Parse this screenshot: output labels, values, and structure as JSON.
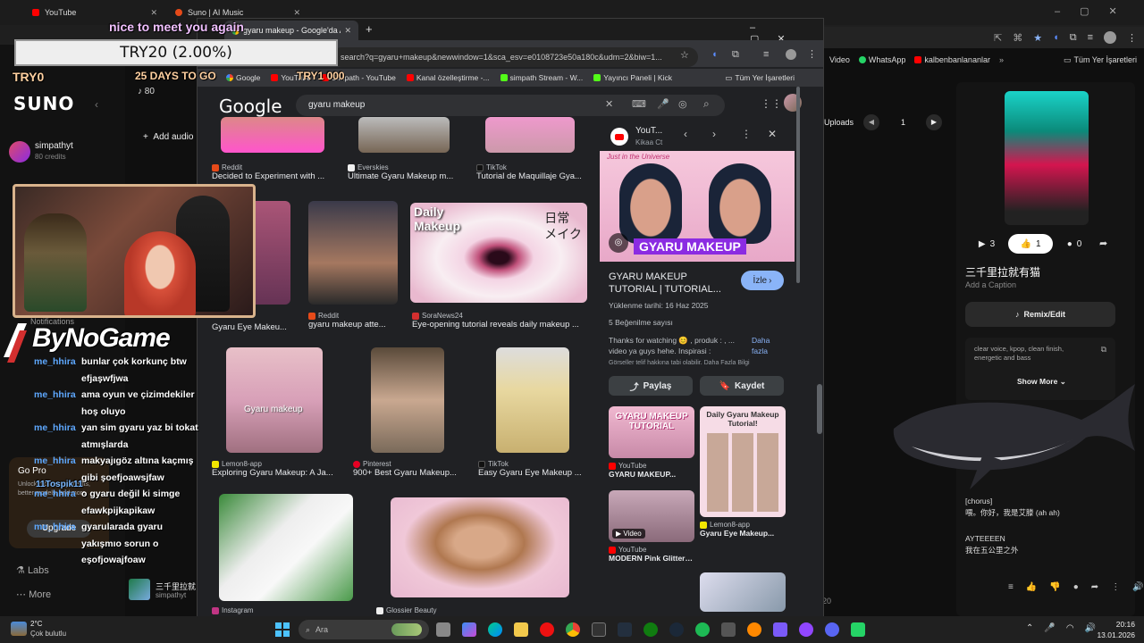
{
  "background_browser": {
    "tabs": [
      {
        "label": "YouTube"
      },
      {
        "label": "Suno | AI Music"
      }
    ],
    "bookmarks_right": [
      "Video",
      "WhatsApp",
      "kalbenbanlananlar",
      "Tüm Yer İşaretleri"
    ]
  },
  "suno": {
    "logo": "SUNO",
    "credits_count": "80",
    "user_name": "simpathyt",
    "user_credits": "80 credits",
    "add_audio_label": "Add audio",
    "notifications_label": "Notifications",
    "go_pro": {
      "title": "Go Pro",
      "subtitle": "Unlock more song credits, better models, and more",
      "upgrade_label": "Upgrade"
    },
    "labs_label": "Labs",
    "more_label": "More",
    "bottom_song": {
      "title": "三千里拉就",
      "artist": "simpathyt"
    },
    "uploads_label": "Uploads",
    "page_number": "1",
    "right_panel": {
      "stats": {
        "plays": "3",
        "likes": "1",
        "comments": "0"
      },
      "song_title": "三千里拉就有猫",
      "add_caption": "Add a Caption",
      "remix_label": "Remix/Edit",
      "style_text": "clear voice, kpop, clean finish, energetic and bass",
      "show_more": "Show More",
      "lyrics": [
        "[chorus]",
        "喂。你好，我是艾滕 (ah ah)",
        "AYTEEEEN",
        "我在五公里之外"
      ],
      "time_fragment": "20"
    }
  },
  "stream_overlay": {
    "top_message": "nice to meet you again",
    "try_rate": "TRY20 (2.00%)",
    "try0": "TRY0",
    "days_to_go": "25 DAYS TO GO",
    "try1000": "TRY1 000",
    "brand": "ByNoGame",
    "chat": [
      {
        "user": "me_hhira",
        "msg": "bunlar çok korkunç btw efjaşwfjwa"
      },
      {
        "user": "me_hhira",
        "msg": "ama oyun ve çizimdekiler hoş oluyo"
      },
      {
        "user": "me_hhira",
        "msg": "yan sim gyaru yaz bi tokat atmışlarda"
      },
      {
        "user": "me_hhira",
        "msg": "makyajıgöz altına kaçmış gibi şoefjoawsjfaw"
      },
      {
        "user": "me_hhira",
        "msg": "o gyaru değil ki simge efawkpijkapikaw"
      },
      {
        "user": "me_hhira",
        "msg": "gyarularada gyaru yakışmıo sorun o eşofjowajfoaw"
      }
    ],
    "donation": "11Tospik11"
  },
  "chrome": {
    "tab_title": "gyaru makeup - Google'da Ara",
    "url": "search?q=gyaru+makeup&newwindow=1&sca_esv=e0108723e50a180c&udm=2&biw=1...",
    "bookmarks": [
      "Google",
      "YouTube",
      "Simpath - YouTube",
      "Kanal özelleştirme -...",
      "simpath Stream - W...",
      "Yayıncı Paneli | Kick",
      "Tüm Yer İşaretleri"
    ]
  },
  "google": {
    "logo": "Google",
    "query": "gyaru makeup",
    "results": [
      {
        "source": "Reddit",
        "title": "Decided to Experiment with ...",
        "color": "#e64a19"
      },
      {
        "source": "Everskies",
        "title": "Ultimate Gyaru Makeup m...",
        "color": "#f0f0f0"
      },
      {
        "source": "TikTok",
        "title": "Tutorial de Maquillaje Gya...",
        "color": "#111111"
      },
      {
        "source": "",
        "title": "Gyaru Eye Makeu...",
        "color": "#888888"
      },
      {
        "source": "Reddit",
        "title": "gyaru makeup atte...",
        "color": "#e64a19"
      },
      {
        "source": "SoraNews24",
        "title": "Eye-opening tutorial reveals daily makeup ...",
        "color": "#d32f2f"
      },
      {
        "source": "Lemon8-app",
        "title": "Exploring Gyaru Makeup: A Ja...",
        "color": "#f2e600"
      },
      {
        "source": "Pinterest",
        "title": "900+ Best Gyaru Makeup...",
        "color": "#e60023"
      },
      {
        "source": "TikTok",
        "title": "Easy Gyaru Eye Makeup ...",
        "color": "#111111"
      },
      {
        "source": "Instagram",
        "title": "",
        "color": "#c13584"
      },
      {
        "source": "Glossier Beauty",
        "title": "",
        "color": "#eeeeee"
      }
    ],
    "image_text": {
      "daily": "Daily",
      "makeup": "Makeup",
      "jp1": "日常",
      "jp2": "メイク",
      "gyaru_overlay": "Gyaru makeup"
    },
    "panel": {
      "source_name": "YouT...",
      "channel": "Kikaa Ct",
      "thumb_text": "GYARU MAKEUP",
      "thumb_top": "Just in the Universe",
      "title": "GYARU MAKEUP TUTORIAL | TUTORIAL...",
      "watch_label": "İzle",
      "upload_date": "Yüklenme tarihi: 16 Haz 2025",
      "likes": "5 Beğenilme sayısı",
      "description": "Thanks for watching 😊 , produk : , ... video ya guys hehe. Inspirasi :",
      "more_label": "Daha fazla",
      "copyright": "Görseller telif hakkına tabi olabilir. Daha Fazla Bilgi",
      "share_label": "Paylaş",
      "save_label": "Kaydet",
      "related": [
        {
          "source": "YouTube",
          "title": "GYARU MAKEUP...",
          "thumb": "GYARU MAKEUP TUTORIAL"
        },
        {
          "source": "Lemon8-app",
          "title": "Gyaru Eye Makeup...",
          "thumb": "Daily Gyaru Makeup Tutorial!"
        },
        {
          "source": "YouTube",
          "title": "MODERN Pink Glittery...",
          "thumb": "Video"
        }
      ]
    }
  },
  "taskbar": {
    "weather_temp": "2°C",
    "weather_desc": "Çok bulutlu",
    "search_placeholder": "Ara",
    "time": "20:16",
    "date": "13.01.2026"
  }
}
